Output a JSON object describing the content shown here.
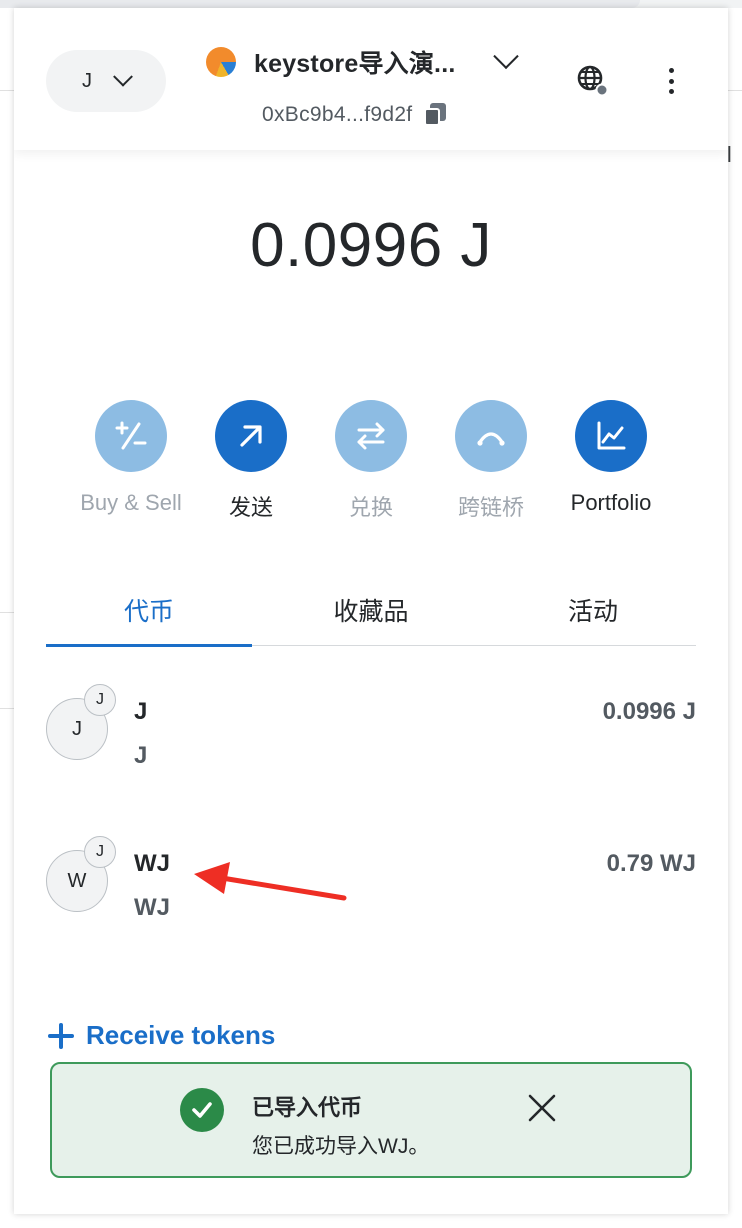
{
  "background": {
    "fragment_text": "il"
  },
  "header": {
    "network_label": "J",
    "account_name": "keystore导入演...",
    "address": "0xBc9b4...f9d2f",
    "icons": {
      "network_chevron": "chevron-down-icon",
      "account_chevron": "chevron-down-icon",
      "copy": "copy-icon",
      "globe": "globe-icon",
      "menu": "kebab-menu-icon"
    }
  },
  "balance": "0.0996 J",
  "actions": [
    {
      "label": "Buy & Sell",
      "icon": "plus-minus-icon",
      "enabled": false
    },
    {
      "label": "发送",
      "icon": "arrow-up-right-icon",
      "enabled": true
    },
    {
      "label": "兑换",
      "icon": "swap-icon",
      "enabled": false
    },
    {
      "label": "跨链桥",
      "icon": "bridge-icon",
      "enabled": false
    },
    {
      "label": "Portfolio",
      "icon": "chart-icon",
      "enabled": true
    }
  ],
  "tabs": [
    {
      "label": "代币",
      "active": true
    },
    {
      "label": "收藏品",
      "active": false
    },
    {
      "label": "活动",
      "active": false
    }
  ],
  "tokens": [
    {
      "avatar": "J",
      "badge": "J",
      "name": "J",
      "symbol": "J",
      "balance": "0.0996 J"
    },
    {
      "avatar": "W",
      "badge": "J",
      "name": "WJ",
      "symbol": "WJ",
      "balance": "0.79 WJ"
    }
  ],
  "receive_tokens_label": "Receive tokens",
  "toast": {
    "title": "已导入代币",
    "message": "您已成功导入WJ。"
  },
  "colors": {
    "primary": "#1a6ec8",
    "primary_muted": "#8dbce3",
    "success": "#2b8a48",
    "toast_bg": "#e6f1ea",
    "annotation_arrow": "#ee2e24"
  }
}
